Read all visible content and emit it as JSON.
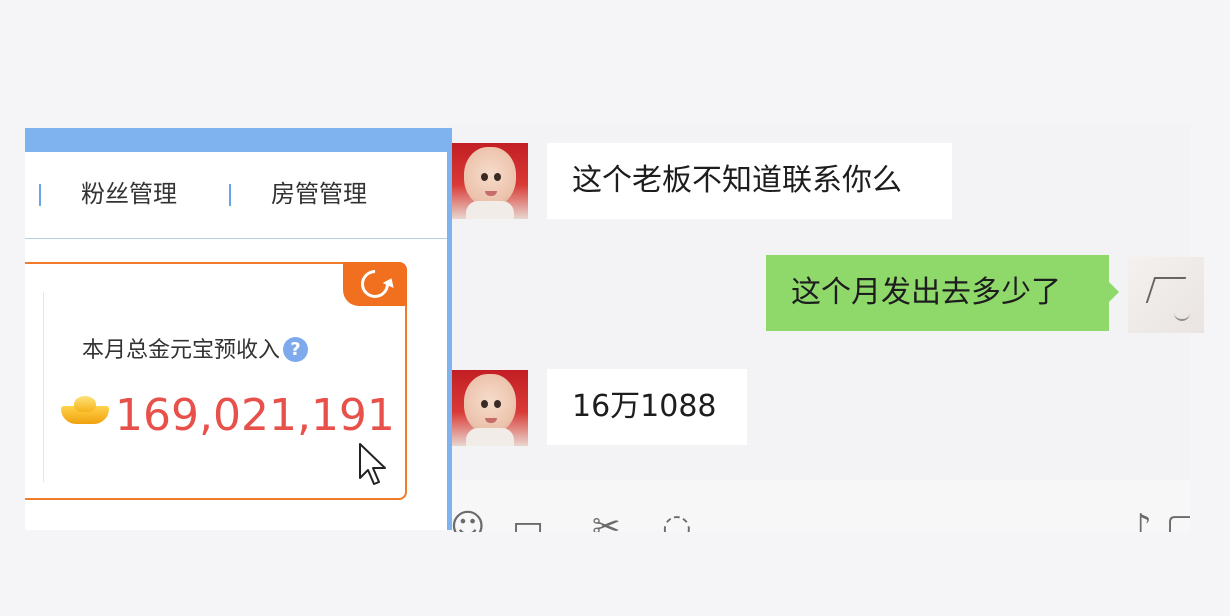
{
  "dashboard": {
    "tabs": [
      {
        "label": "粉丝管理"
      },
      {
        "label": "房管管理"
      }
    ],
    "income_card": {
      "label": "本月总金元宝预收入",
      "help_symbol": "?",
      "value": "169,021,191",
      "icons": [
        "refresh-icon",
        "gold-ingot-icon",
        "help-icon",
        "mouse-cursor-icon"
      ]
    }
  },
  "chat": {
    "messages": [
      {
        "side": "left",
        "sender_avatar": "baby-photo-avatar",
        "text": "这个老板不知道联系你么"
      },
      {
        "side": "right",
        "sender_avatar": "handwriting-avatar",
        "text": "这个月发出去多少了"
      },
      {
        "side": "left",
        "sender_avatar": "baby-photo-avatar",
        "text": "16万1088"
      }
    ],
    "toolbar_icons": [
      "emoji-icon",
      "folder-icon",
      "scissors-icon",
      "chat-bubble-icon",
      "microphone-icon",
      "window-icon"
    ]
  },
  "colors": {
    "panel_border": "#7eb3ef",
    "card_accent": "#f07020",
    "value_red": "#e8504a",
    "bubble_green": "#8fd96a",
    "bubble_white": "#ffffff"
  }
}
